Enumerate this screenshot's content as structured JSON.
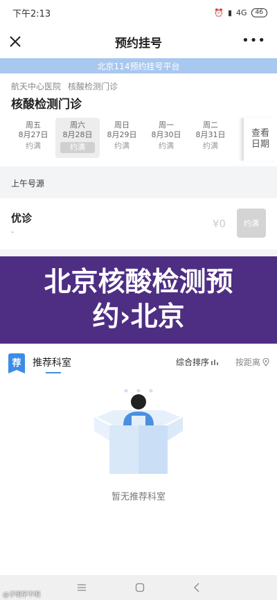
{
  "status_bar": {
    "time": "下午2:13",
    "network": "4G",
    "battery": "46"
  },
  "nav": {
    "title": "预约挂号",
    "more": "•••"
  },
  "platform_banner": "北京114预约挂号平台",
  "hospital": {
    "breadcrumb": [
      "航天中心医院",
      "核酸检测门诊"
    ],
    "department": "核酸检测门诊"
  },
  "dates": [
    {
      "weekday": "周五",
      "date": "8月27日",
      "status": "约满",
      "active": false
    },
    {
      "weekday": "周六",
      "date": "8月28日",
      "status": "约满",
      "active": true
    },
    {
      "weekday": "周日",
      "date": "8月29日",
      "status": "约满",
      "active": false
    },
    {
      "weekday": "周一",
      "date": "8月30日",
      "status": "约满",
      "active": false
    },
    {
      "weekday": "周二",
      "date": "8月31日",
      "status": "约满",
      "active": false
    }
  ],
  "view_dates": "查看日期",
  "section": {
    "morning": "上午号源"
  },
  "slot": {
    "name": "优诊",
    "sub": "-",
    "price": "¥0",
    "button": "约满"
  },
  "overlay": {
    "text": "北京核酸检测预约›北京"
  },
  "recommend": {
    "icon": "荐",
    "title": "推荐科室",
    "sort": "综合排序",
    "distance": "按距离",
    "empty": "暂无推荐科室"
  },
  "watermark": "@子明字不明",
  "colors": {
    "accent": "#3c8ce6",
    "banner": "#a9c8ef",
    "overlay": "#4e2e83"
  }
}
